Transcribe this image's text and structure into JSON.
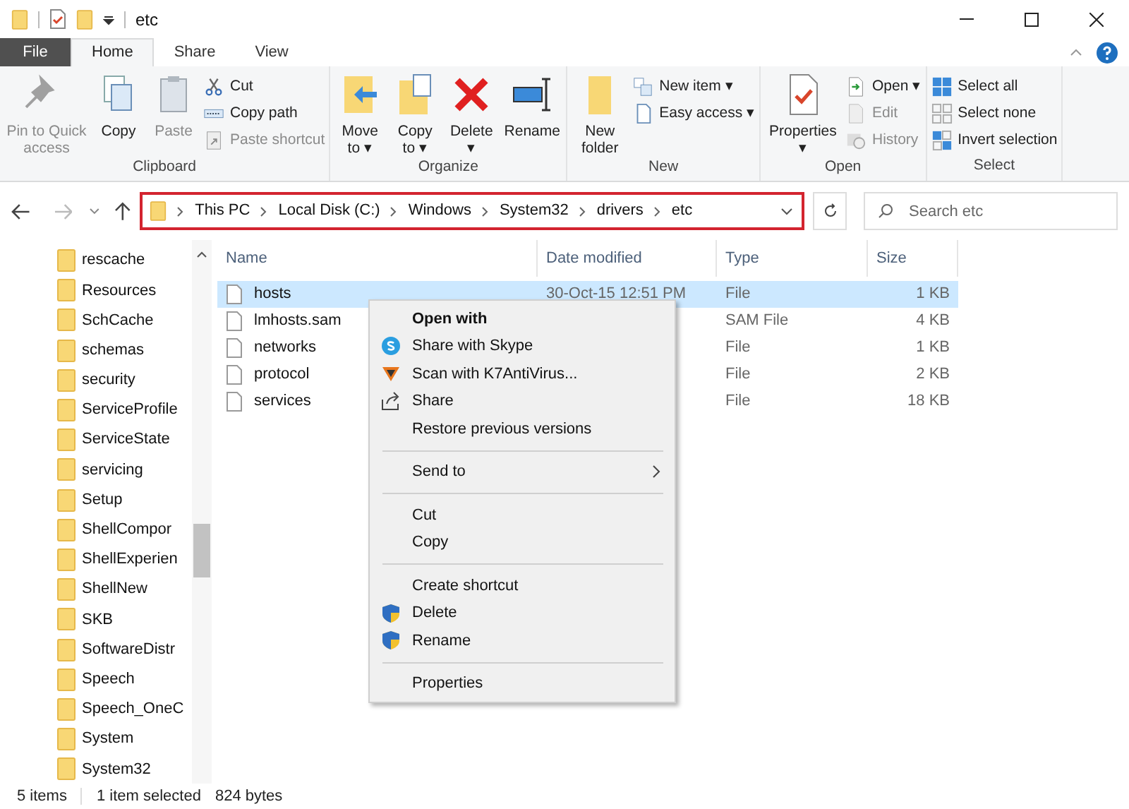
{
  "window": {
    "title": "etc"
  },
  "ribbon_tabs": [
    {
      "label": "File",
      "kind": "file",
      "selected": false
    },
    {
      "label": "Home",
      "kind": "tab",
      "selected": true
    },
    {
      "label": "Share",
      "kind": "tab",
      "selected": false
    },
    {
      "label": "View",
      "kind": "tab",
      "selected": false
    }
  ],
  "ribbon_groups": [
    {
      "name": "Clipboard",
      "items": [
        {
          "kind": "large",
          "label": "Pin to Quick access",
          "disabled": true
        },
        {
          "kind": "large",
          "label": "Copy",
          "disabled": false
        },
        {
          "kind": "large",
          "label": "Paste",
          "disabled": true
        },
        {
          "kind": "stack",
          "items": [
            {
              "label": "Cut",
              "disabled": false
            },
            {
              "label": "Copy path",
              "disabled": false
            },
            {
              "label": "Paste shortcut",
              "disabled": true
            }
          ]
        }
      ]
    },
    {
      "name": "Organize",
      "items": [
        {
          "kind": "large",
          "label": "Move to ▾",
          "disabled": false
        },
        {
          "kind": "large",
          "label": "Copy to ▾",
          "disabled": false
        },
        {
          "kind": "large",
          "label": "Delete ▾",
          "disabled": false
        },
        {
          "kind": "large",
          "label": "Rename",
          "disabled": false
        }
      ]
    },
    {
      "name": "New",
      "items": [
        {
          "kind": "large",
          "label": "New folder",
          "disabled": false
        },
        {
          "kind": "stack",
          "items": [
            {
              "label": "New item ▾",
              "disabled": false
            },
            {
              "label": "Easy access ▾",
              "disabled": false
            }
          ]
        }
      ]
    },
    {
      "name": "Open",
      "items": [
        {
          "kind": "large",
          "label": "Properties ▾",
          "disabled": false
        },
        {
          "kind": "stack",
          "items": [
            {
              "label": "Open ▾",
              "disabled": false
            },
            {
              "label": "Edit",
              "disabled": true
            },
            {
              "label": "History",
              "disabled": true
            }
          ]
        }
      ]
    },
    {
      "name": "Select",
      "items": [
        {
          "kind": "stack",
          "items": [
            {
              "label": "Select all",
              "disabled": false
            },
            {
              "label": "Select none",
              "disabled": false
            },
            {
              "label": "Invert selection",
              "disabled": false
            }
          ]
        }
      ]
    }
  ],
  "address": {
    "path": [
      "This PC",
      "Local Disk (C:)",
      "Windows",
      "System32",
      "drivers",
      "etc"
    ]
  },
  "search": {
    "placeholder": "Search etc"
  },
  "nav_pane": {
    "items": [
      "rescache",
      "Resources",
      "SchCache",
      "schemas",
      "security",
      "ServiceProfile",
      "ServiceState",
      "servicing",
      "Setup",
      "ShellCompor",
      "ShellExperien",
      "ShellNew",
      "SKB",
      "SoftwareDistr",
      "Speech",
      "Speech_OneC",
      "System",
      "System32"
    ]
  },
  "file_list": {
    "columns": [
      "Name",
      "Date modified",
      "Type",
      "Size"
    ],
    "rows": [
      {
        "name": "hosts",
        "date": "30-Oct-15 12:51 PM",
        "type": "File",
        "size": "1 KB",
        "selected": true
      },
      {
        "name": "lmhosts.sam",
        "type": "SAM File",
        "size": "4 KB",
        "selected": false
      },
      {
        "name": "networks",
        "type": "File",
        "size": "1 KB",
        "selected": false
      },
      {
        "name": "protocol",
        "type": "File",
        "size": "2 KB",
        "selected": false
      },
      {
        "name": "services",
        "type": "File",
        "size": "18 KB",
        "selected": false
      }
    ]
  },
  "context_menu": {
    "groups": [
      [
        {
          "label": "Open with",
          "kind": "default"
        },
        {
          "label": "Share with Skype",
          "kind": "skype"
        },
        {
          "label": "Scan with K7AntiVirus...",
          "kind": "antivirus"
        },
        {
          "label": "Share",
          "kind": "share"
        },
        {
          "label": "Restore previous versions",
          "kind": "plain"
        }
      ],
      [
        {
          "label": "Send to",
          "kind": "submenu"
        }
      ],
      [
        {
          "label": "Cut",
          "kind": "plain"
        },
        {
          "label": "Copy",
          "kind": "plain"
        }
      ],
      [
        {
          "label": "Create shortcut",
          "kind": "plain"
        },
        {
          "label": "Delete",
          "kind": "shield"
        },
        {
          "label": "Rename",
          "kind": "shield"
        }
      ],
      [
        {
          "label": "Properties",
          "kind": "plain"
        }
      ]
    ]
  },
  "status_bar": {
    "count": "5 items",
    "selection": "1 item selected",
    "size": "824 bytes"
  }
}
